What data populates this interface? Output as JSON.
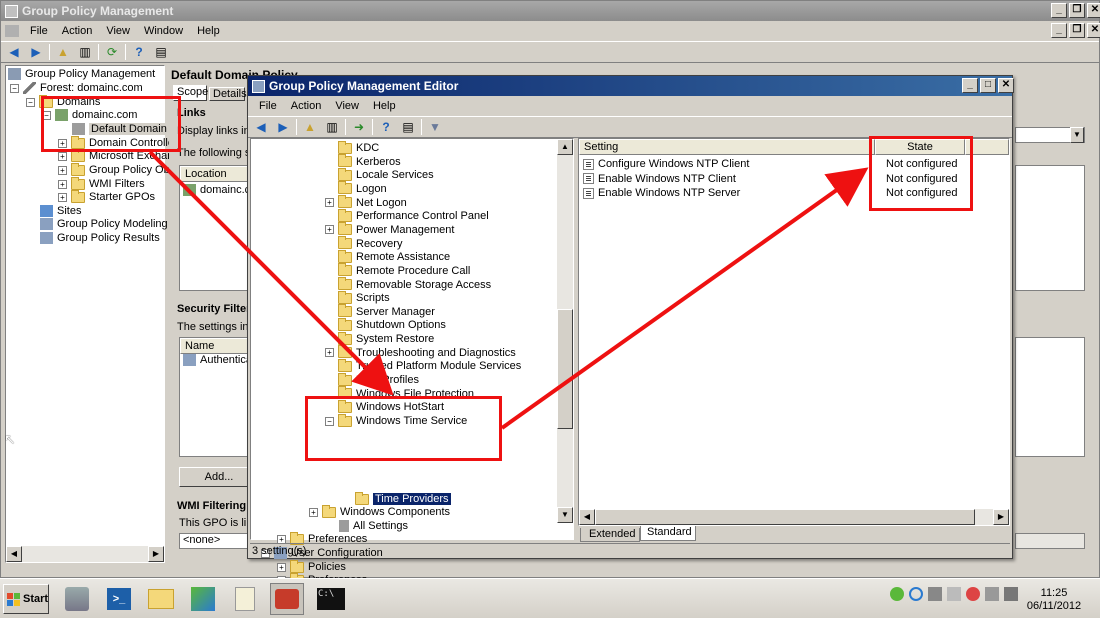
{
  "main_window": {
    "title": "Group Policy Management",
    "menu": [
      "File",
      "Action",
      "View",
      "Window",
      "Help"
    ],
    "tree": {
      "root": "Group Policy Management",
      "forest": "Forest: domainc.com",
      "domains": "Domains",
      "domain": "domainc.com",
      "items": [
        "Default Domain Po",
        "Domain Controller",
        "Microsoft Exchan",
        "Group Policy Obje",
        "WMI Filters",
        "Starter GPOs"
      ],
      "sites": "Sites",
      "modeling": "Group Policy Modeling",
      "results": "Group Policy Results"
    },
    "detail": {
      "title": "Default Domain Policy",
      "tabs": [
        "Scope",
        "Details"
      ],
      "links_heading": "Links",
      "links_desc": "Display links in th",
      "following": "The following site",
      "location_header": "Location",
      "location_value": "domainc.com",
      "security_heading": "Security Filteri",
      "security_desc": "The settings in th",
      "name_header": "Name",
      "name_value": "Authenticate",
      "add_button": "Add...",
      "wmi_heading": "WMI Filtering",
      "wmi_desc": "This GPO is linke",
      "wmi_value": "<none>"
    }
  },
  "editor": {
    "title": "Group Policy Management Editor",
    "menu": [
      "File",
      "Action",
      "View",
      "Help"
    ],
    "tree": [
      {
        "label": "KDC",
        "expand": false
      },
      {
        "label": "Kerberos",
        "expand": false
      },
      {
        "label": "Locale Services",
        "expand": false
      },
      {
        "label": "Logon",
        "expand": false
      },
      {
        "label": "Net Logon",
        "expand": true
      },
      {
        "label": "Performance Control Panel",
        "expand": false
      },
      {
        "label": "Power Management",
        "expand": true
      },
      {
        "label": "Recovery",
        "expand": false
      },
      {
        "label": "Remote Assistance",
        "expand": false
      },
      {
        "label": "Remote Procedure Call",
        "expand": false
      },
      {
        "label": "Removable Storage Access",
        "expand": false
      },
      {
        "label": "Scripts",
        "expand": false
      },
      {
        "label": "Server Manager",
        "expand": false
      },
      {
        "label": "Shutdown Options",
        "expand": false
      },
      {
        "label": "System Restore",
        "expand": false
      },
      {
        "label": "Troubleshooting and Diagnostics",
        "expand": true
      },
      {
        "label": "Trusted Platform Module Services",
        "expand": false
      },
      {
        "label": "User Profiles",
        "expand": false
      },
      {
        "label": "Windows File Protection",
        "expand": false
      },
      {
        "label": "Windows HotStart",
        "expand": false
      },
      {
        "label": "Windows Time Service",
        "expand": true
      }
    ],
    "time_providers": "Time Providers",
    "windows_components": "Windows Components",
    "all_settings": "All Settings",
    "preferences": "Preferences",
    "user_configuration": "User Configuration",
    "policies": "Policies",
    "preferences2": "Preferences",
    "columns": {
      "setting": "Setting",
      "state": "State"
    },
    "settings": [
      {
        "name": "Configure Windows NTP Client",
        "state": "Not configured"
      },
      {
        "name": "Enable Windows NTP Client",
        "state": "Not configured"
      },
      {
        "name": "Enable Windows NTP Server",
        "state": "Not configured"
      }
    ],
    "tabs": [
      "Extended",
      "Standard"
    ],
    "status": "3 setting(s)"
  },
  "taskbar": {
    "start": "Start",
    "time": "11:25",
    "date": "06/11/2012"
  },
  "colors": {
    "annotation": "#ee1111",
    "selection": "#0a246a"
  }
}
